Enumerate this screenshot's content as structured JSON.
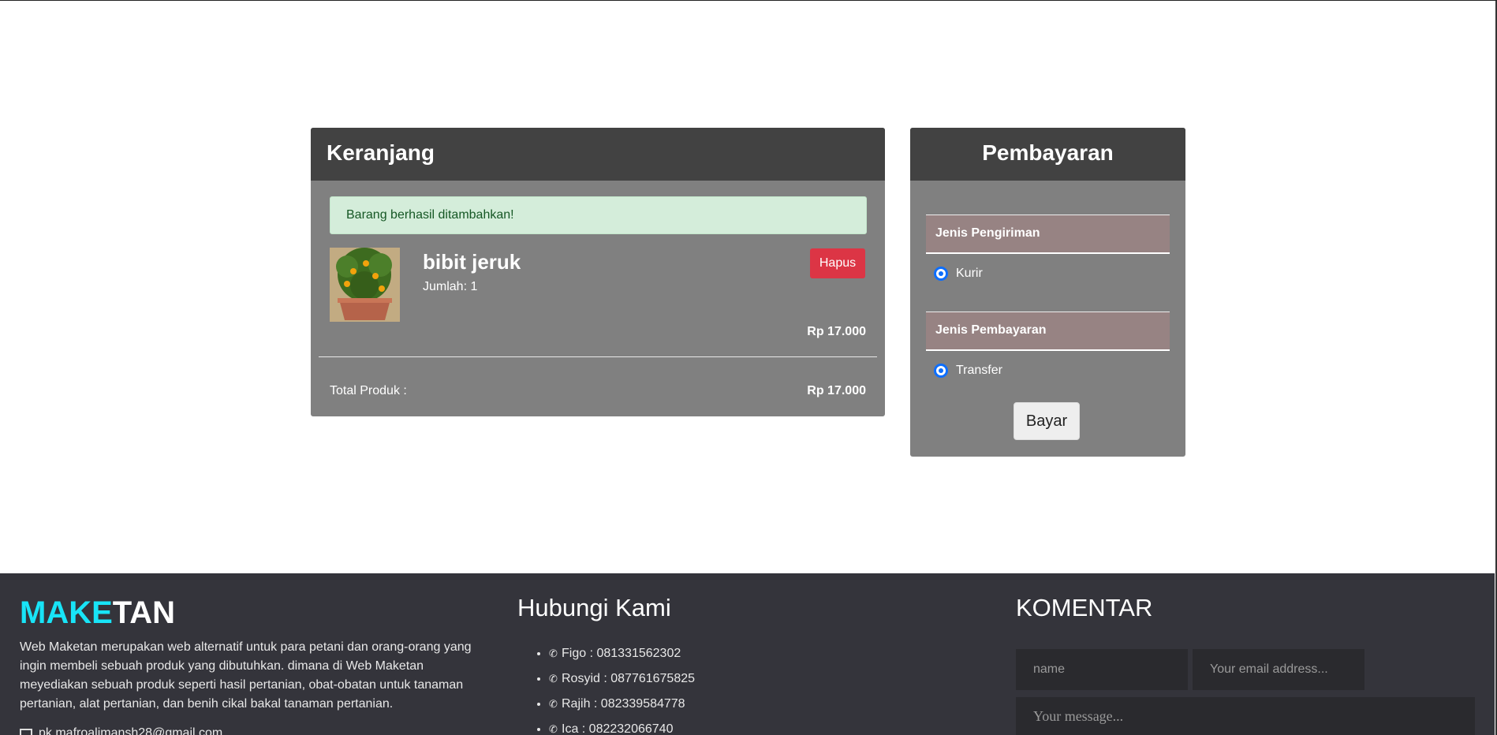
{
  "cart": {
    "title": "Keranjang",
    "alert": "Barang berhasil ditambahkan!",
    "item": {
      "name": "bibit jeruk",
      "quantity_label": "Jumlah: 1",
      "delete_label": "Hapus",
      "price": "Rp 17.000"
    },
    "total_label": "Total Produk :",
    "total_value": "Rp 17.000"
  },
  "payment": {
    "title": "Pembayaran",
    "shipping_heading": "Jenis Pengiriman",
    "shipping_option": "Kurir",
    "payment_heading": "Jenis Pembayaran",
    "payment_option": "Transfer",
    "pay_button": "Bayar"
  },
  "footer": {
    "brand_part1": "MAKE",
    "brand_part2": "TAN",
    "about": "Web Maketan merupakan web alternatif untuk para petani dan orang-orang yang ingin membeli sebuah produk yang dibutuhkan. dimana di Web Maketan meyediakan sebuah produk seperti hasil pertanian, obat-obatan untuk tanaman pertanian, alat pertanian, dan benih cikal bakal tanaman pertanian.",
    "email": "pk.mafroalimansh28@gmail.com",
    "contact_title": "Hubungi Kami",
    "contacts": [
      "Figo : 081331562302",
      "Rosyid : 087761675825",
      "Rajih : 082339584778",
      "Ica : 082232066740"
    ],
    "comment_title": "KOMENTAR",
    "name_placeholder": "name",
    "email_placeholder": "Your email address...",
    "message_placeholder": "Your message..."
  },
  "colors": {
    "card_header": "#424242",
    "card_body": "#808080",
    "danger": "#dc3545",
    "alert_bg": "#d4edda",
    "footer_bg": "#34343b",
    "brand_accent": "#18e4f7"
  }
}
